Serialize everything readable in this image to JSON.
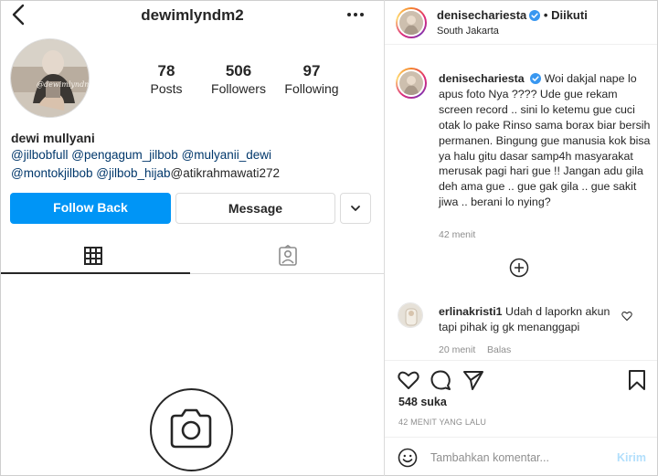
{
  "profile": {
    "username": "dewimlyndm2",
    "avatar_watermark": "@dewimlyndm",
    "stats": [
      {
        "value": "78",
        "label": "Posts"
      },
      {
        "value": "506",
        "label": "Followers"
      },
      {
        "value": "97",
        "label": "Following"
      }
    ],
    "display_name": "dewi mullyani",
    "bio": {
      "line1": [
        "@jilbobfull",
        "@pengagum_jilbob",
        "@mulyanii_dewi"
      ],
      "line2": [
        "@montokjilbob",
        "@jilbob_hijab"
      ],
      "line2_plain": "@atikrahmawati272"
    },
    "buttons": {
      "follow_back": "Follow Back",
      "message": "Message"
    }
  },
  "post": {
    "author": "denisechariesta",
    "separator": "•",
    "follow_state": "Diikuti",
    "location": "South Jakarta",
    "caption": "Woi dakjal nape lo apus foto Nya ???? Ude gue rekam screen record .. sini lo ketemu gue cuci otak lo pake Rinso sama borax biar bersih permanen. Bingung gue manusia kok bisa ya halu gitu dasar samp4h masyarakat merusak pagi hari gue !! Jangan adu gila deh ama gue .. gue gak gila .. gue sakit jiwa .. berani lo nying?",
    "caption_time": "42 menit",
    "comment": {
      "user": "erlinakristi1",
      "text": "Udah d laporkn akun tapi pihak ig gk menanggapi",
      "time": "20 menit",
      "reply": "Balas"
    },
    "likes": "548 suka",
    "posted_ago": "42 MENIT YANG LALU",
    "add_comment_placeholder": "Tambahkan komentar...",
    "post_button": "Kirim"
  },
  "colors": {
    "accent_blue": "#0095f6",
    "verified_blue": "#3897f0",
    "link_navy": "#00376b",
    "muted_gray": "#8e8e8e"
  },
  "icons": [
    "back-arrow-icon",
    "more-options-icon",
    "grid-icon",
    "tagged-icon",
    "camera-icon",
    "verified-badge-icon",
    "plus-circle-icon",
    "heart-icon",
    "comment-icon",
    "share-icon",
    "bookmark-icon",
    "emoji-icon",
    "chevron-down-icon"
  ]
}
